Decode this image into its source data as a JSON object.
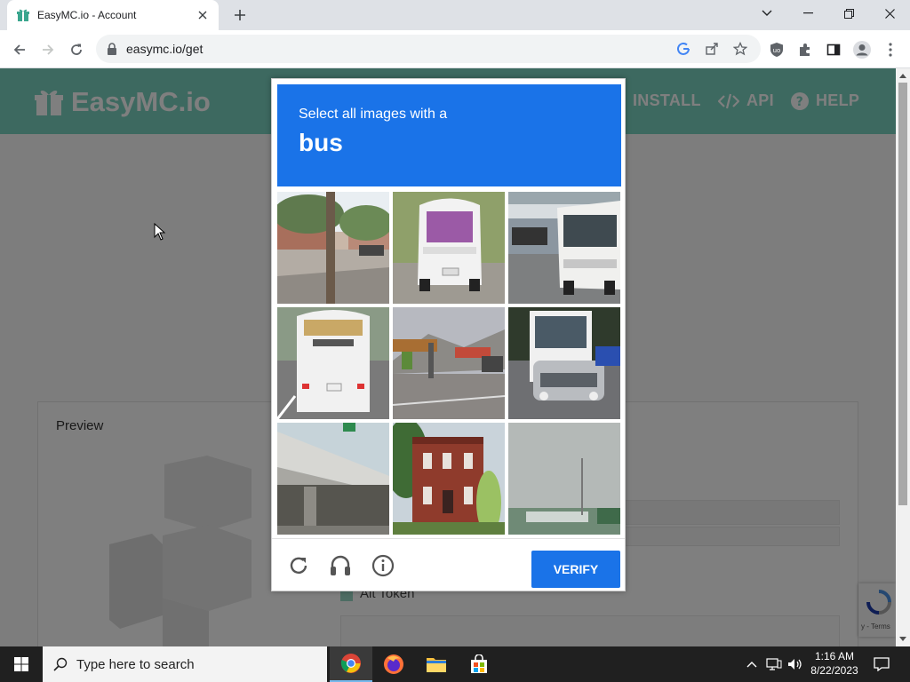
{
  "browser": {
    "tab_title": "EasyMC.io - Account",
    "url": "easymc.io/get"
  },
  "site": {
    "logo_text": "EasyMC.io",
    "nav": [
      {
        "label": "INSTALL",
        "icon": "download-icon"
      },
      {
        "label": "API",
        "icon": "code-icon"
      },
      {
        "label": "HELP",
        "icon": "question-circle-icon"
      }
    ],
    "preview_label": "Preview",
    "alt_token_label": "Alt Token",
    "recaptcha_badge_text": "y - Terms"
  },
  "captcha": {
    "instruction": "Select all images with a",
    "target": "bus",
    "tiles": [
      {
        "id": 1,
        "content": "street-tree"
      },
      {
        "id": 2,
        "content": "white-minibus-rear"
      },
      {
        "id": 3,
        "content": "bus-at-stop"
      },
      {
        "id": 4,
        "content": "white-bus-rear"
      },
      {
        "id": 5,
        "content": "roadside-sign"
      },
      {
        "id": 6,
        "content": "bus-front-traffic"
      },
      {
        "id": 7,
        "content": "highway-overpass"
      },
      {
        "id": 8,
        "content": "brick-house"
      },
      {
        "id": 9,
        "content": "grey-sky-pole"
      }
    ],
    "verify_label": "VERIFY",
    "footer_icons": [
      "reload-icon",
      "headphones-icon",
      "info-icon"
    ]
  },
  "taskbar": {
    "search_placeholder": "Type here to search",
    "apps": [
      "chrome-icon",
      "firefox-icon",
      "file-explorer-icon",
      "store-icon"
    ],
    "time": "1:16 AM",
    "date": "8/22/2023"
  },
  "colors": {
    "header_teal": "#7bd2c0",
    "captcha_blue": "#1a73e8"
  }
}
